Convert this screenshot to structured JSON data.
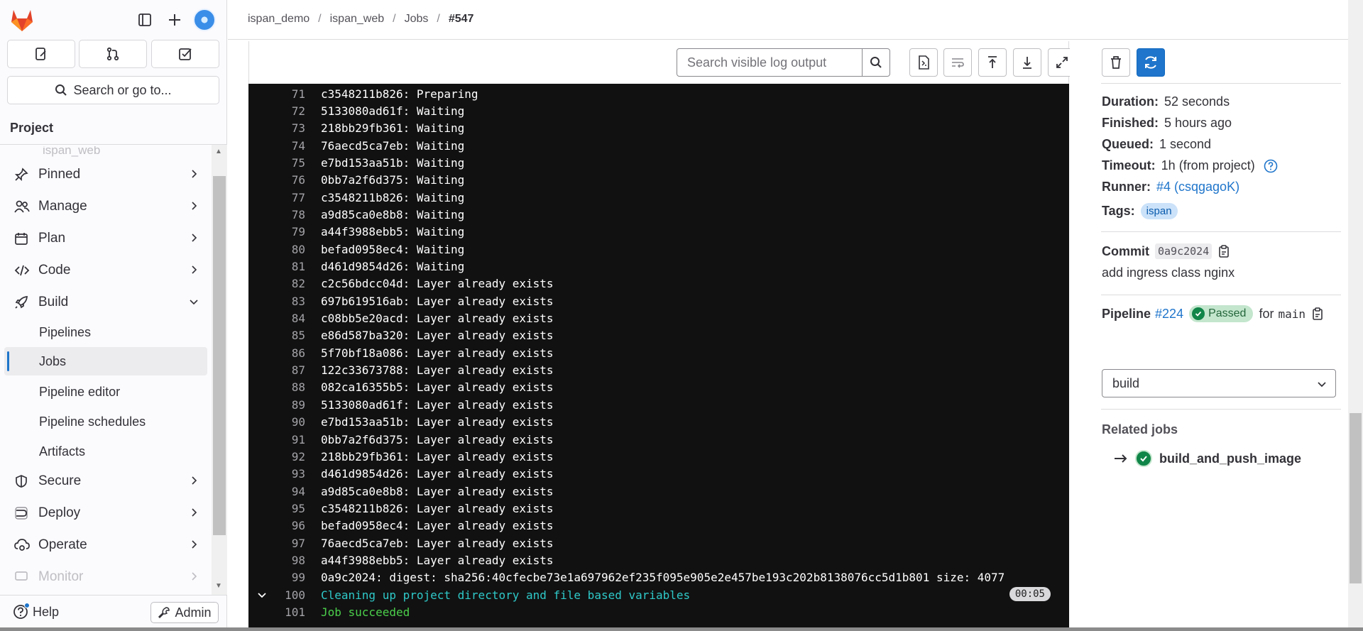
{
  "breadcrumb": [
    {
      "label": "ispan_demo"
    },
    {
      "label": "ispan_web"
    },
    {
      "label": "Jobs"
    },
    {
      "label": "#547"
    }
  ],
  "sidebar": {
    "search_label": "Search or go to...",
    "section_title": "Project",
    "faded_item": "ispan_web",
    "items": [
      {
        "label": "Pinned",
        "icon": "pin-icon"
      },
      {
        "label": "Manage",
        "icon": "users-icon"
      },
      {
        "label": "Plan",
        "icon": "calendar-icon"
      },
      {
        "label": "Code",
        "icon": "code-icon"
      },
      {
        "label": "Build",
        "icon": "rocket-icon"
      }
    ],
    "build_subitems": [
      {
        "label": "Pipelines"
      },
      {
        "label": "Jobs"
      },
      {
        "label": "Pipeline editor"
      },
      {
        "label": "Pipeline schedules"
      },
      {
        "label": "Artifacts"
      }
    ],
    "items_after": [
      {
        "label": "Secure",
        "icon": "shield-icon"
      },
      {
        "label": "Deploy",
        "icon": "deploy-icon"
      },
      {
        "label": "Operate",
        "icon": "cloud-gear-icon"
      },
      {
        "label": "Monitor",
        "icon": "monitor-icon"
      }
    ],
    "help_label": "Help",
    "admin_label": "Admin"
  },
  "log_toolbar": {
    "search_placeholder": "Search visible log output"
  },
  "log": {
    "lines": [
      {
        "n": "71",
        "t": "c3548211b826: Preparing"
      },
      {
        "n": "72",
        "t": "5133080ad61f: Waiting"
      },
      {
        "n": "73",
        "t": "218bb29fb361: Waiting"
      },
      {
        "n": "74",
        "t": "76aecd5ca7eb: Waiting"
      },
      {
        "n": "75",
        "t": "e7bd153aa51b: Waiting"
      },
      {
        "n": "76",
        "t": "0bb7a2f6d375: Waiting"
      },
      {
        "n": "77",
        "t": "c3548211b826: Waiting"
      },
      {
        "n": "78",
        "t": "a9d85ca0e8b8: Waiting"
      },
      {
        "n": "79",
        "t": "a44f3988ebb5: Waiting"
      },
      {
        "n": "80",
        "t": "befad0958ec4: Waiting"
      },
      {
        "n": "81",
        "t": "d461d9854d26: Waiting"
      },
      {
        "n": "82",
        "t": "c2c56bdcc04d: Layer already exists"
      },
      {
        "n": "83",
        "t": "697b619516ab: Layer already exists"
      },
      {
        "n": "84",
        "t": "c08bb5e20acd: Layer already exists"
      },
      {
        "n": "85",
        "t": "e86d587ba320: Layer already exists"
      },
      {
        "n": "86",
        "t": "5f70bf18a086: Layer already exists"
      },
      {
        "n": "87",
        "t": "122c33673788: Layer already exists"
      },
      {
        "n": "88",
        "t": "082ca16355b5: Layer already exists"
      },
      {
        "n": "89",
        "t": "5133080ad61f: Layer already exists"
      },
      {
        "n": "90",
        "t": "e7bd153aa51b: Layer already exists"
      },
      {
        "n": "91",
        "t": "0bb7a2f6d375: Layer already exists"
      },
      {
        "n": "92",
        "t": "218bb29fb361: Layer already exists"
      },
      {
        "n": "93",
        "t": "d461d9854d26: Layer already exists"
      },
      {
        "n": "94",
        "t": "a9d85ca0e8b8: Layer already exists"
      },
      {
        "n": "95",
        "t": "c3548211b826: Layer already exists"
      },
      {
        "n": "96",
        "t": "befad0958ec4: Layer already exists"
      },
      {
        "n": "97",
        "t": "76aecd5ca7eb: Layer already exists"
      },
      {
        "n": "98",
        "t": "a44f3988ebb5: Layer already exists"
      },
      {
        "n": "99",
        "t": "0a9c2024: digest: sha256:40cfecbe73e1a697962ef235f095e905e2e457be193c202b8138076cc5d1b801 size: 4077"
      },
      {
        "n": "100",
        "t": "Cleaning up project directory and file based variables",
        "color": "cyan",
        "collapsible": true,
        "badge": "00:05"
      },
      {
        "n": "101",
        "t": "Job succeeded",
        "color": "green"
      }
    ]
  },
  "job": {
    "duration_label": "Duration:",
    "duration": "52 seconds",
    "finished_label": "Finished:",
    "finished": "5 hours ago",
    "queued_label": "Queued:",
    "queued": "1 second",
    "timeout_label": "Timeout:",
    "timeout": "1h (from project)",
    "runner_label": "Runner:",
    "runner": "#4 (csqgagoK)",
    "tags_label": "Tags:",
    "tag": "ispan",
    "commit_label": "Commit",
    "commit_sha": "0a9c2024",
    "commit_message": "add ingress class nginx",
    "pipeline_label": "Pipeline",
    "pipeline_id": "#224",
    "pipeline_status": "Passed",
    "pipeline_for": "for",
    "pipeline_ref": "main",
    "stage_select": "build",
    "related_title": "Related jobs",
    "related_job": "build_and_push_image"
  },
  "colors": {
    "accent": "#1f75cb",
    "success": "#108548",
    "log_bg": "#111111",
    "log_cyan": "#2fc9c9",
    "log_green": "#4bd04b"
  }
}
